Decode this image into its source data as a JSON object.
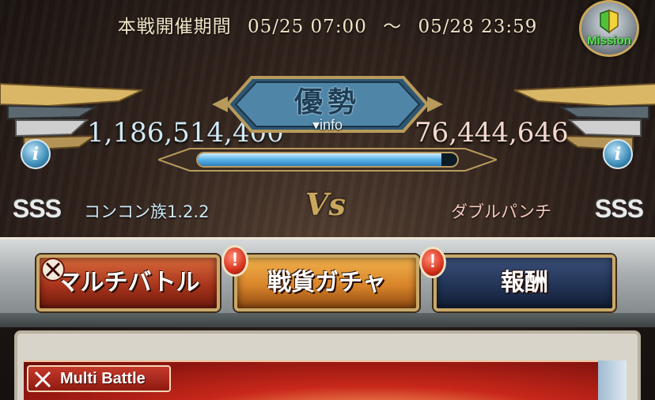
{
  "header": {
    "period_label": "本戦開催期間",
    "start": "05/25 07:00",
    "separator": "〜",
    "end": "05/28 23:59"
  },
  "mission": {
    "label": "Mission"
  },
  "status": {
    "title": "優勢",
    "info_label": "▾info"
  },
  "left_crew": {
    "score": "1,186,514,400",
    "rank": "SSS",
    "name": "コンコン族1.2.2"
  },
  "right_crew": {
    "score": "76,444,646",
    "rank": "SSS",
    "name": "ダブルパンチ"
  },
  "gauge": {
    "fill_fraction": 0.94
  },
  "vs_label": "Vs",
  "tabs": {
    "multi_battle": "マルチバトル",
    "gacha": "戦貨ガチャ",
    "reward": "報酬"
  },
  "alerts": {
    "symbol": "!"
  },
  "info_icon": "i",
  "banner": {
    "label": "Multi Battle"
  },
  "colors": {
    "ally": "#cfe9f5",
    "enemy": "#f4d9cf",
    "gauge": "#5fb7ea",
    "accent_gold": "#c9a75d"
  }
}
